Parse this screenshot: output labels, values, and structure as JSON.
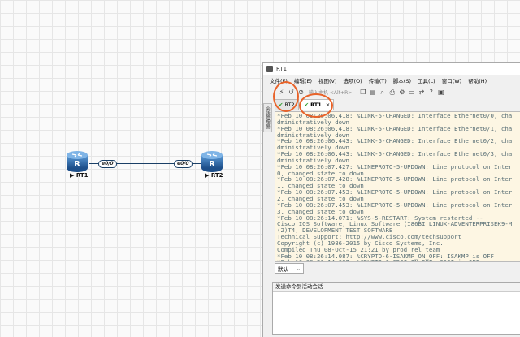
{
  "topology": {
    "routers": [
      {
        "name": "RT1",
        "label": "▶ RT1",
        "glyph": "R"
      },
      {
        "name": "RT2",
        "label": "▶ RT2",
        "glyph": "R"
      }
    ],
    "links": [
      {
        "a_iface": "e0/0",
        "b_iface": "e0/0"
      }
    ],
    "colors": {
      "router": "#2d6cb0",
      "link": "#1a3f66",
      "accent": "#e8632a"
    }
  },
  "window": {
    "title": "RT1",
    "menu": [
      "文件(F)",
      "编辑(E)",
      "视图(V)",
      "选项(O)",
      "传输(T)",
      "脚本(S)",
      "工具(L)",
      "窗口(W)",
      "帮助(H)"
    ],
    "toolbar": {
      "input_placeholder": "输入主机 <Alt+R>"
    },
    "tabs": [
      {
        "label": "RT2",
        "check": "✔",
        "active": false
      },
      {
        "label": "RT1",
        "check": "✔",
        "active": true,
        "close": "×"
      }
    ],
    "side_tab": "会话管理器",
    "terminal_lines": [
      "*Feb 10 08:26:06.418: %LINK-5-CHANGED: Interface Ethernet0/0, cha",
      "dministratively down",
      "*Feb 10 08:26:06.418: %LINK-5-CHANGED: Interface Ethernet0/1, cha",
      "dministratively down",
      "*Feb 10 08:26:06.443: %LINK-5-CHANGED: Interface Ethernet0/2, cha",
      "dministratively down",
      "*Feb 10 08:26:06.443: %LINK-5-CHANGED: Interface Ethernet0/3, cha",
      "dministratively down",
      "*Feb 10 08:26:07.427: %LINEPROTO-5-UPDOWN: Line protocol on Inter",
      "0, changed state to down",
      "*Feb 10 08:26:07.428: %LINEPROTO-5-UPDOWN: Line protocol on Inter",
      "1, changed state to down",
      "*Feb 10 08:26:07.453: %LINEPROTO-5-UPDOWN: Line protocol on Inter",
      "2, changed state to down",
      "*Feb 10 08:26:07.453: %LINEPROTO-5-UPDOWN: Line protocol on Inter",
      "3, changed state to down",
      "*Feb 10 08:26:14.071: %SYS-5-RESTART: System restarted --",
      "Cisco IOS Software, Linux Software (I86BI_LINUX-ADVENTERPRISEK9-M",
      "(2)T4, DEVELOPMENT TEST SOFTWARE",
      "Technical Support: http://www.cisco.com/techsupport",
      "Copyright (c) 1986-2015 by Cisco Systems, Inc.",
      "Compiled Thu 08-Oct-15 21:21 by prod_rel_team",
      "*Feb 10 08:26:14.087: %CRYPTO-6-ISAKMP_ON_OFF: ISAKMP is OFF",
      "*Feb 10 08:26:14.087: %CRYPTO-6-GDOI_ON_OFF: GDOI is OFF"
    ],
    "select_value": "默认",
    "send_box_header": "发送命令到活动会话"
  }
}
